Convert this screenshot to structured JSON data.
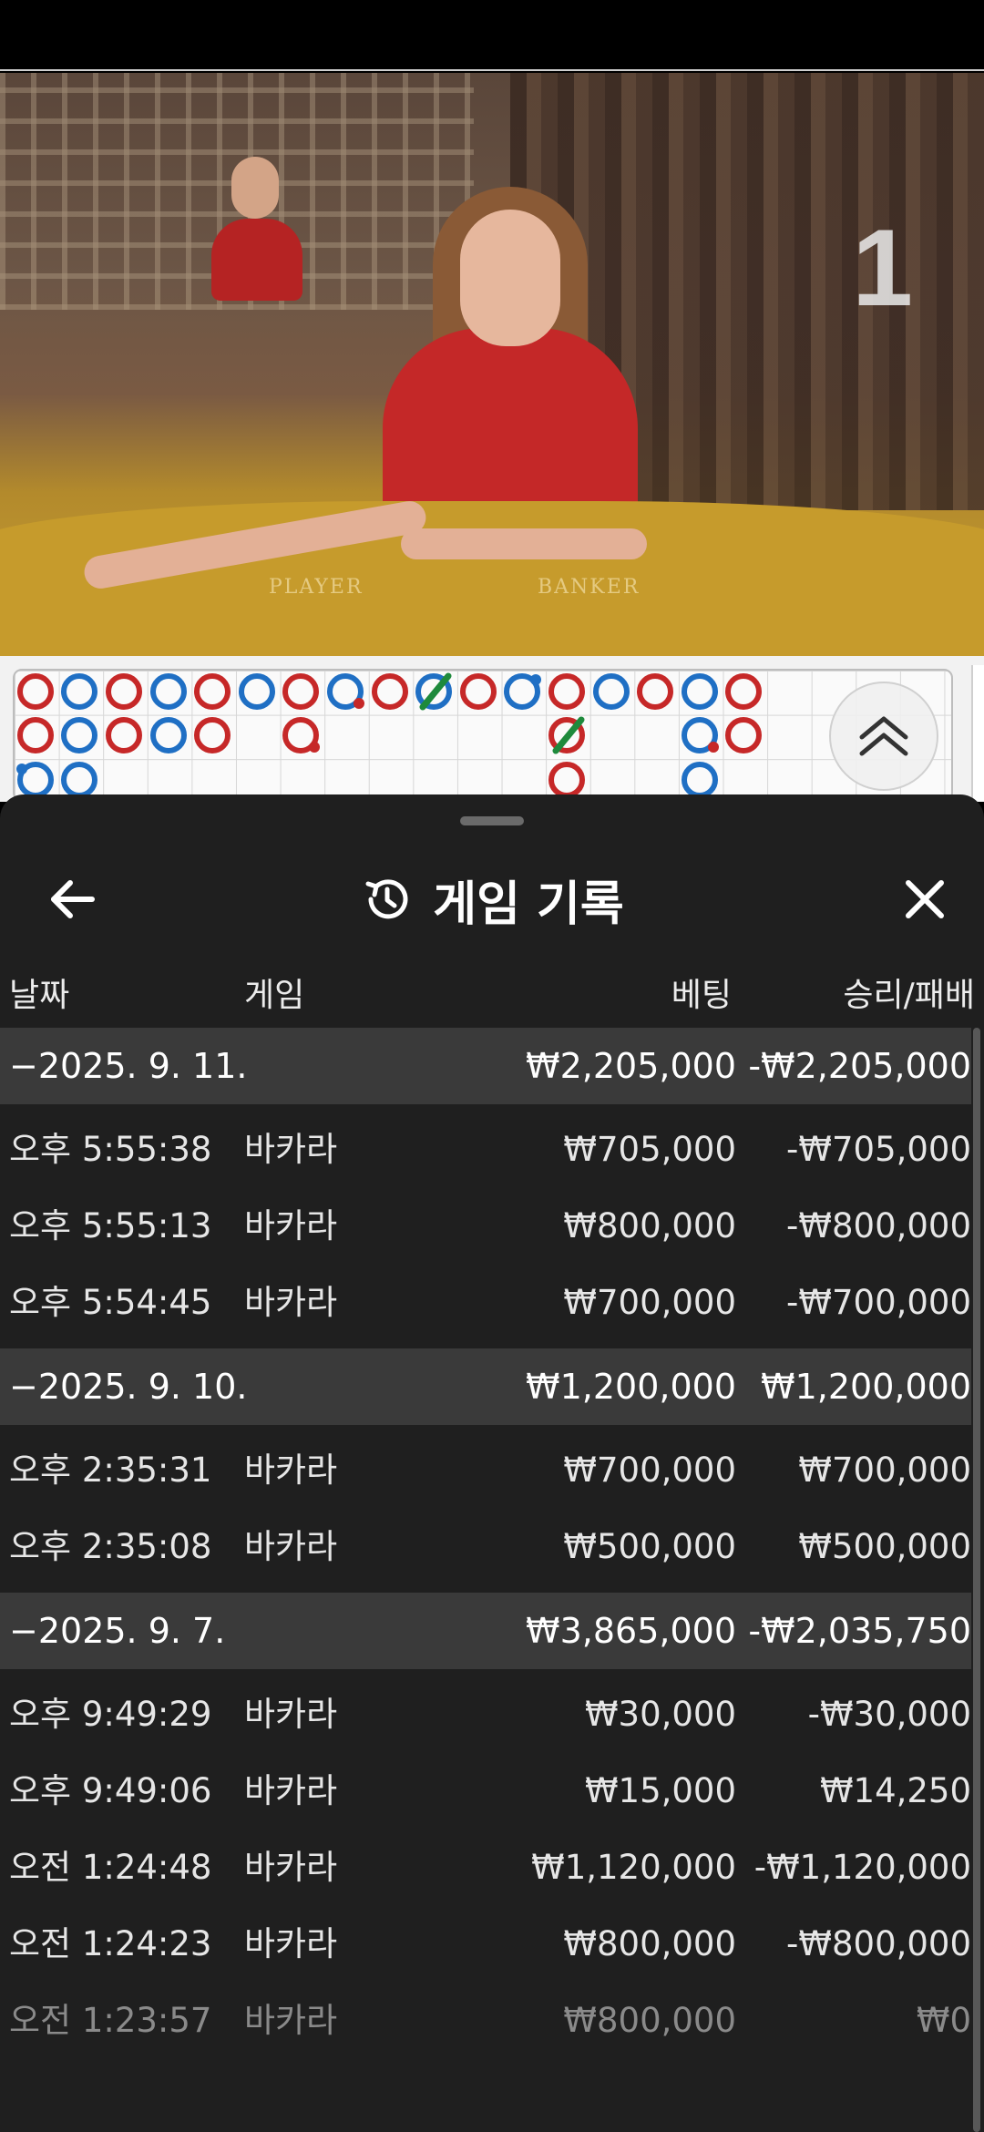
{
  "table_number": "1",
  "video_labels": {
    "player": "PLAYER",
    "banker": "BANKER"
  },
  "header": {
    "title": "게임 기록",
    "back_icon": "arrow-left-icon",
    "history_icon": "history-icon",
    "close_icon": "close-icon"
  },
  "columns": {
    "date": "날짜",
    "game": "게임",
    "bet": "베팅",
    "win_loss": "승리/패배"
  },
  "groups": [
    {
      "date": "2025. 9. 11.",
      "bet": "₩2,205,000",
      "win_loss": "-₩2,205,000",
      "rows": [
        {
          "time": "오후 5:55:38",
          "game": "바카라",
          "bet": "₩705,000",
          "win_loss": "-₩705,000"
        },
        {
          "time": "오후 5:55:13",
          "game": "바카라",
          "bet": "₩800,000",
          "win_loss": "-₩800,000"
        },
        {
          "time": "오후 5:54:45",
          "game": "바카라",
          "bet": "₩700,000",
          "win_loss": "-₩700,000"
        }
      ]
    },
    {
      "date": "2025. 9. 10.",
      "bet": "₩1,200,000",
      "win_loss": "₩1,200,000",
      "rows": [
        {
          "time": "오후 2:35:31",
          "game": "바카라",
          "bet": "₩700,000",
          "win_loss": "₩700,000"
        },
        {
          "time": "오후 2:35:08",
          "game": "바카라",
          "bet": "₩500,000",
          "win_loss": "₩500,000"
        }
      ]
    },
    {
      "date": "2025. 9. 7.",
      "bet": "₩3,865,000",
      "win_loss": "-₩2,035,750",
      "rows": [
        {
          "time": "오후 9:49:29",
          "game": "바카라",
          "bet": "₩30,000",
          "win_loss": "-₩30,000"
        },
        {
          "time": "오후 9:49:06",
          "game": "바카라",
          "bet": "₩15,000",
          "win_loss": "₩14,250"
        },
        {
          "time": "오전 1:24:48",
          "game": "바카라",
          "bet": "₩1,120,000",
          "win_loss": "-₩1,120,000"
        },
        {
          "time": "오전 1:24:23",
          "game": "바카라",
          "bet": "₩800,000",
          "win_loss": "-₩800,000"
        },
        {
          "time": "오전 1:23:57",
          "game": "바카라",
          "bet": "₩800,000",
          "win_loss": "₩0"
        }
      ]
    }
  ],
  "colors": {
    "banker": "#c62828",
    "player": "#1f6fc4",
    "tie": "#1e8a3c",
    "sheet_bg": "#1f1f1f",
    "group_bg": "#3a3a3a"
  }
}
